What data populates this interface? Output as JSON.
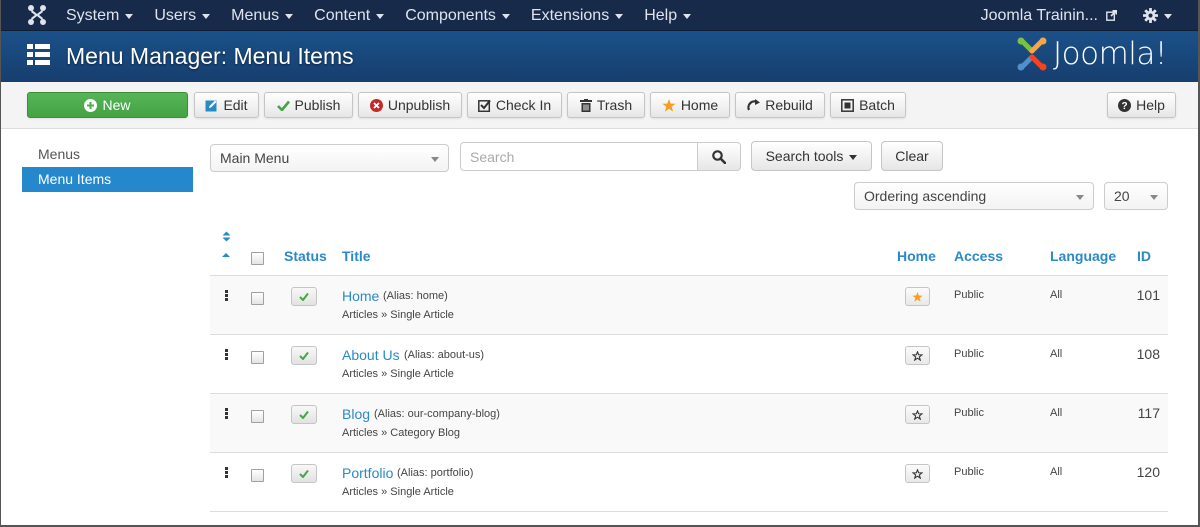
{
  "navbar": {
    "menu": [
      {
        "label": "System"
      },
      {
        "label": "Users"
      },
      {
        "label": "Menus"
      },
      {
        "label": "Content"
      },
      {
        "label": "Components"
      },
      {
        "label": "Extensions"
      },
      {
        "label": "Help"
      }
    ],
    "site_name": "Joomla Trainin...",
    "icons": {
      "logo": "joomla-icon",
      "external": "external-link-icon",
      "settings": "gear-icon"
    }
  },
  "header": {
    "title": "Menu Manager: Menu Items",
    "brand": "Joomla!",
    "icon": "list-icon"
  },
  "toolbar": {
    "buttons": [
      {
        "label": "New",
        "icon": "plus-circle-icon"
      },
      {
        "label": "Edit",
        "icon": "edit-icon"
      },
      {
        "label": "Publish",
        "icon": "check-icon"
      },
      {
        "label": "Unpublish",
        "icon": "times-circle-icon"
      },
      {
        "label": "Check In",
        "icon": "checkbox-icon"
      },
      {
        "label": "Trash",
        "icon": "trash-icon"
      },
      {
        "label": "Home",
        "icon": "star-icon"
      },
      {
        "label": "Rebuild",
        "icon": "refresh-icon"
      },
      {
        "label": "Batch",
        "icon": "square-icon"
      }
    ],
    "help_label": "Help"
  },
  "sidebar": {
    "items": [
      {
        "label": "Menus",
        "active": false
      },
      {
        "label": "Menu Items",
        "active": true
      }
    ]
  },
  "filters": {
    "menu_select": "Main Menu",
    "search_placeholder": "Search",
    "search_value": "",
    "search_tools_label": "Search tools",
    "clear_label": "Clear",
    "ordering_select": "Ordering ascending",
    "limit_select": "20"
  },
  "table": {
    "columns": {
      "status": "Status",
      "title": "Title",
      "home": "Home",
      "access": "Access",
      "language": "Language",
      "id": "ID"
    },
    "rows": [
      {
        "title": "Home",
        "alias": "(Alias: home)",
        "type": "Articles » Single Article",
        "published": true,
        "is_home": true,
        "access": "Public",
        "language": "All",
        "id": "101"
      },
      {
        "title": "About Us",
        "alias": "(Alias: about-us)",
        "type": "Articles » Single Article",
        "published": true,
        "is_home": false,
        "access": "Public",
        "language": "All",
        "id": "108"
      },
      {
        "title": "Blog",
        "alias": "(Alias: our-company-blog)",
        "type": "Articles » Category Blog",
        "published": true,
        "is_home": false,
        "access": "Public",
        "language": "All",
        "id": "117"
      },
      {
        "title": "Portfolio",
        "alias": "(Alias: portfolio)",
        "type": "Articles » Single Article",
        "published": true,
        "is_home": false,
        "access": "Public",
        "language": "All",
        "id": "120"
      }
    ]
  },
  "colors": {
    "navbar": "#172a4a",
    "header": "#1a5189",
    "accent": "#2a8ac5",
    "new_button": "#4cae4c",
    "sidebar_active": "#2588cc",
    "home_star": "#f4a01c",
    "publish_check": "#46a546"
  }
}
